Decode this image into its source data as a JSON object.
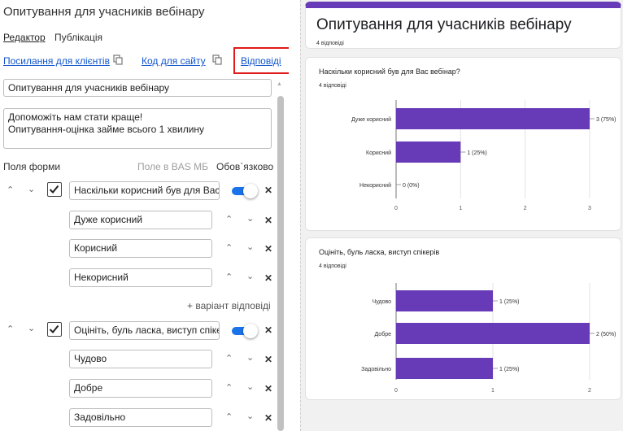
{
  "editor": {
    "title": "Опитування для учасників вебінару",
    "tabs": [
      "Редактор",
      "Публікація"
    ],
    "links": {
      "clients": "Посилання для клієнтів",
      "code": "Код для сайту",
      "responses": "Відповіді"
    },
    "form_title_value": "Опитування для учасників вебінару",
    "description_lines": [
      "Допоможіть нам стати краще!",
      "Опитування-оцінка займе всього 1 хвилину"
    ],
    "fields_header": {
      "label": "Поля форми",
      "bas": "Поле в BAS МБ",
      "required": "Обов`язково"
    },
    "questions": [
      {
        "text": "Наскільки корисний був для Вас",
        "required": true,
        "options": [
          "Дуже корисний",
          "Корисний",
          "Некорисний"
        ]
      },
      {
        "text": "Оцініть, буль ласка, виступ спіке",
        "required": true,
        "options": [
          "Чудово",
          "Добре",
          "Задовільно"
        ]
      }
    ],
    "add_variant": "+ варіант відповіді"
  },
  "preview": {
    "title": "Опитування для учасників вебінару",
    "count": "4 відповіді"
  },
  "colors": {
    "accent": "#673ab7",
    "toggle": "#1a73e8",
    "link": "#1155cc",
    "highlight": "#e01a1a"
  },
  "icons": [
    "copy-icon",
    "chevron-up-icon",
    "chevron-down-icon",
    "close-icon",
    "checkbox-checked-icon",
    "toggle-on-icon"
  ],
  "chart_data": [
    {
      "type": "bar",
      "orientation": "horizontal",
      "title": "Наскільки корисний був для Вас вебінар?",
      "subtitle": "4 відповіді",
      "categories": [
        "Дуже корисний",
        "Корисний",
        "Некорисний"
      ],
      "values": [
        3,
        1,
        0
      ],
      "data_labels": [
        "3 (75%)",
        "1 (25%)",
        "0 (0%)"
      ],
      "xlim": [
        0,
        3
      ],
      "xticks": [
        "0",
        "1",
        "2",
        "3"
      ],
      "color": "#673ab7"
    },
    {
      "type": "bar",
      "orientation": "horizontal",
      "title": "Оцініть, буль ласка, виступ спікерів",
      "subtitle": "4 відповіді",
      "categories": [
        "Чудово",
        "Добре",
        "Задовільно"
      ],
      "values": [
        1,
        2,
        1
      ],
      "data_labels": [
        "1 (25%)",
        "2 (50%)",
        "1 (25%)"
      ],
      "xlim": [
        0,
        2
      ],
      "xticks": [
        "0",
        "1",
        "2"
      ],
      "color": "#673ab7"
    }
  ]
}
